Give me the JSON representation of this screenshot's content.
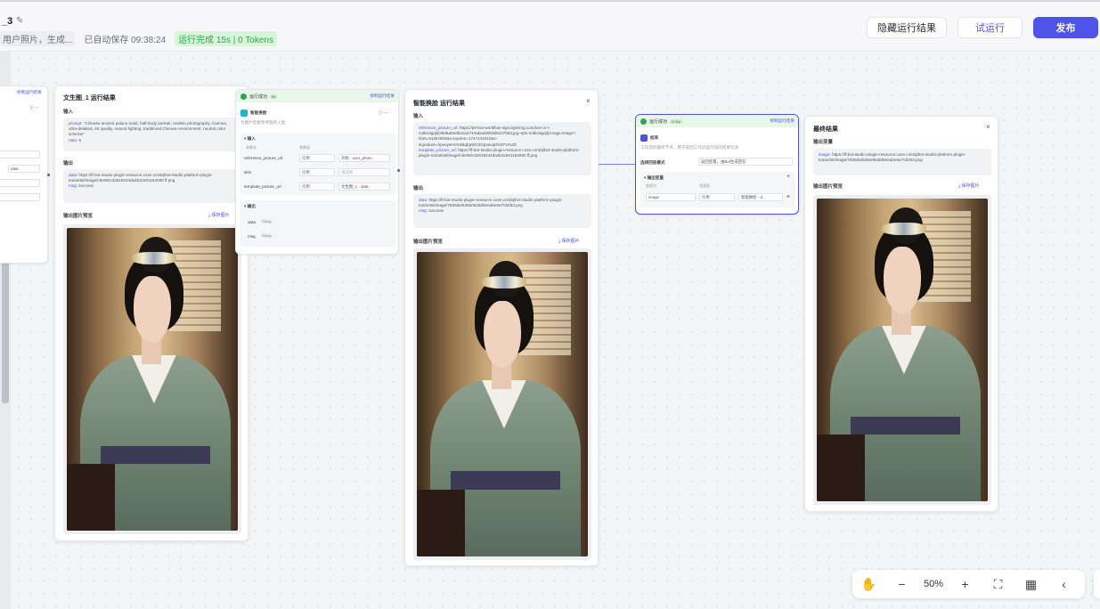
{
  "header": {
    "workflow_name": "_3",
    "description": "用户照片，生成...",
    "autosave": "已自动保存 09:38:24",
    "run_status": "运行完成 15s | 0 Tokens",
    "hide_results_label": "隐藏运行结果",
    "test_run_label": "试运行",
    "publish_label": "发布"
  },
  "left_node": {
    "copy_link": "修制运行结果",
    "select_value": "data"
  },
  "wenshengtu_result": {
    "title": "文生图_1 运行结果",
    "input_label": "输入",
    "input_prompt_key": "prompt",
    "input_prompt": ": \"Chinese ancient palace maid, half-body portrait, realism photography, Cannon, ultra-detailed, 4K quality, natural lighting, traditional Chinese environment, neutral color scheme\"",
    "input_ratio_key": "ratio",
    "input_ratio": ": 5",
    "output_label": "输出",
    "output_data_key": "data",
    "output_data": ": https://lf-bot-studio-plugin-resource.coze.cn/obj/bot-studio-platform-plugin-tos/artist/image/c8e09/cd2918444da4b3c601184090 ff.png",
    "output_msg_key": "msg",
    "output_msg": ": success",
    "preview_label": "输出图片预览",
    "save_label": "保存图片"
  },
  "faceswap_node": {
    "status": "运行成功",
    "time": "9s",
    "copy_link": "修制运行结果",
    "title": "智能换脸",
    "subtitle": "为图片智能参考图的人脸",
    "input_label": "输入",
    "col_name": "参数名",
    "col_value": "参数值",
    "params": [
      {
        "name": "reference_picture_url",
        "mode": "引用",
        "value": "开始 - user_photo"
      },
      {
        "name": "skin",
        "mode": "引用",
        "value": "请选择"
      },
      {
        "name": "template_picture_url",
        "mode": "引用",
        "value": "文生图_1 - data"
      }
    ],
    "output_label": "输出",
    "outputs": [
      {
        "name": "data",
        "type": "String"
      },
      {
        "name": "msg",
        "type": "String"
      }
    ]
  },
  "faceswap_result": {
    "title": "智能换脸 运行结果",
    "input_label": "输入",
    "ref_key": "reference_picture_url",
    "ref_value": ": https://p9-bot-workflow-sign.byteimg.com/tos-cn-i-mdko3gqilj/39d6abed0a1a4743abea80b3d6107b83.jpg~tplv-mdko3gqilj-image.image?rk3s=81d4c505&x-expires=1747441010&x-signature=hpevysHs%2BqbpWC0Gqosvqd%2FV%3D",
    "tpl_key": "template_picture_url",
    "tpl_value": ": https://lf-bot-studio-plugin-resource.coze.cn/obj/bot-studio-platform-plugin-tos/artist/image/c8e09/cd2918444da4b3c601184090 ff.png",
    "output_label": "输出",
    "out_data_key": "data",
    "out_data": ": https://lf-bot-studio-plugin-resource.coze.cn/obj/bot-studio-platform-plugin-tos/artist/image/7836de/628e063dd9eeabe6e/7d2/5d.png",
    "out_msg_key": "msg",
    "out_msg": ": success",
    "preview_label": "输出图片预览",
    "save_label": "保存图片"
  },
  "end_node": {
    "status": "运行成功",
    "time": "0.01s",
    "copy_link": "修制运行结果",
    "title": "结束",
    "subtitle": "工作流的最终节点，用于返回工作流运行后的结果信息",
    "mode_label": "选择回答模式",
    "mode_value": "返回变量，由Bot生成回答",
    "output_var_label": "输出变量",
    "col_name": "变量名",
    "col_value": "变量值",
    "var_name": "image",
    "var_mode": "引用",
    "var_value": "智能换脸 - d..."
  },
  "final_result": {
    "title": "最终结果",
    "output_var_label": "输出变量",
    "image_key": "image",
    "image_value": ": https://lf-bot-studio-plugin-resource.coze.cn/obj/bot-studio-platform-plugin-tos/artist/image/7836de/628e063dd9eeabe6e/7d2/5d.png",
    "preview_label": "输出图片预览",
    "save_label": "保存图片"
  },
  "toolbar": {
    "hand_icon": "hand-icon",
    "zoom_out": "−",
    "zoom_level": "50%",
    "zoom_in": "+"
  },
  "colors": {
    "accent": "#4d53e8",
    "success": "#2ea44f",
    "canvas": "#f4f5f7"
  }
}
